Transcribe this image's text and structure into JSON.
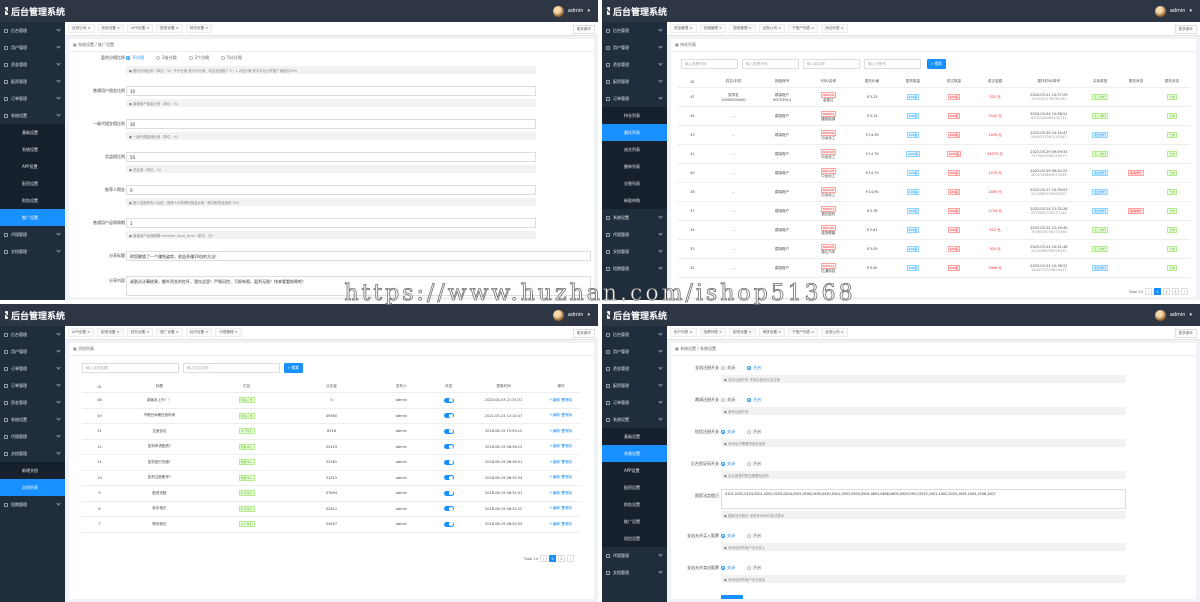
{
  "app": {
    "title": "后台管理系统",
    "user": "admin",
    "more_ops": "更多操作"
  },
  "colors": {
    "header": "#2e3644",
    "sidebar": "#1f2d3d",
    "accent": "#1890ff",
    "danger": "#f5222d",
    "success": "#52c41a"
  },
  "watermark": "https://www.huzhan.com/ishop51368",
  "q1": {
    "sidebar": [
      "后台管理",
      "用户管理",
      "资金管理",
      "配资管理",
      "订单管理",
      "系统设置"
    ],
    "sidebar_sub": [
      "基础设置",
      "系统设置",
      "APP设置",
      "配资设置",
      "财务设置",
      "推广设置"
    ],
    "sidebar_after": [
      "代理管理",
      "文档管理"
    ],
    "tabs": [
      "证券公司",
      "系统设置",
      "APP设置",
      "配资设置",
      "财务设置"
    ],
    "breadcrumb": "系统设置 / 推广设置",
    "rows": [
      {
        "label": "盈利分佣比例",
        "radios": [
          "不分佣",
          "2倍分佣",
          "3个分佣",
          "5分分佣"
        ],
        "hint": "盈利分佣比例（单位：%）不予分佣 表示不分佣，收益全给推广人；1,2倍分佣 表示平台分享推广佣金的20%"
      },
      {
        "label": "普通用户佣金比例",
        "value": "10",
        "hint": "普通用户佣金比例（单位：%）"
      },
      {
        "label": "一级代理金佣比例",
        "value": "30",
        "hint": "一级代理金佣比例（单位：%）"
      },
      {
        "label": "总监佣比例",
        "value": "50",
        "hint": "总监佣（单位：%）"
      },
      {
        "label": "推荐人佣金",
        "value": "0",
        "hint": "推介给推荐有人后进，推荐人可获得的佣金比例（首次配资费用的 5%）"
      },
      {
        "label": "普通用户返佣周期",
        "value": "1",
        "hint": "普通用户返佣周期 member_back_time（单位：天）"
      },
      {
        "label": "分享标题",
        "value": "帮您解锁了一个赚钱姿势，收益多赚10倍的方法!"
      },
      {
        "label": "分享内容",
        "value": "或割试计算结果，额外资金的杠杆，我在这里！严格风控，亏损有限，盈利无限！快来看看结果吧！"
      }
    ]
  },
  "q2": {
    "sidebar_top": [
      "后台管理",
      "用户管理",
      "资金管理",
      "配资管理",
      "订单管理"
    ],
    "sidebar_sub": [
      "持仓列表",
      "委托列表",
      "成交列表",
      "撤单列表",
      "交割列表",
      "新股申购"
    ],
    "sidebar_after": [
      "系统设置",
      "代理管理",
      "文档管理",
      "短期管理"
    ],
    "tabs": [
      "资金管理",
      "充值管理",
      "提现管理",
      "证券公司",
      "子账户列表",
      "持仓列表"
    ],
    "breadcrumb": "持仓列表",
    "search": [
      "输入股票代码",
      "输入股票代码",
      "输入单名称",
      "输入子账号",
      "搜索"
    ],
    "headers": [
      "ID",
      "姓名/手机",
      "报盘账号",
      "代码/名称",
      "委托价格",
      "委托数量",
      "成交数量",
      "成交金额",
      "委托时间/单号",
      "买卖类型",
      "委托状态",
      "委托状态"
    ],
    "rows": [
      {
        "id": "47",
        "name": "张学友",
        "phone": "19000000000",
        "acct": "模拟账户",
        "acct2": "60753914",
        "code": "000016",
        "sname": "金爱达",
        "price": "￥3.25",
        "qty": "100股",
        "done": "100股",
        "amt": "325 元",
        "time": "2024-03-22 10:37:29",
        "no": "1925321176252183",
        "type": "买入委托",
        "st1": "",
        "st2": "已成"
      },
      {
        "id": "44",
        "name": "--",
        "phone": "",
        "acct": "模拟账户",
        "acct2": "",
        "code": "300609",
        "sname": "捷锐能源",
        "price": "￥5.14",
        "qty": "300股",
        "done": "300股",
        "amt": "1542 元",
        "time": "2024-03-04 10:58:51",
        "no": "6792348464100721",
        "type": "买入委托",
        "st1": "",
        "st2": "已成"
      },
      {
        "id": "43",
        "name": "--",
        "phone": "",
        "acct": "模拟账户",
        "acct2": "",
        "code": "600128",
        "sname": "中远化工",
        "price": "￥14.39",
        "qty": "100股",
        "done": "100股",
        "amt": "1439 元",
        "time": "2023-03-30 10:15:47",
        "no": "5065337591142547",
        "type": "卖出委托",
        "st1": "",
        "st2": "已成"
      },
      {
        "id": "41",
        "name": "--",
        "phone": "",
        "acct": "模拟账户",
        "acct2": "",
        "code": "600128",
        "sname": "中远化工",
        "price": "￥14.79",
        "qty": "3000股",
        "done": "3000股",
        "amt": "44370 元",
        "time": "2023-03-29 09:49:33",
        "no": "7575090000054573",
        "type": "买入委托",
        "st1": "",
        "st2": "已成"
      },
      {
        "id": "40",
        "name": "--",
        "phone": "",
        "acct": "模拟账户",
        "acct2": "",
        "code": "600128",
        "sname": "中远化工",
        "price": "￥14.79",
        "qty": "100股",
        "done": "100股",
        "amt": "1479 元",
        "time": "2023-03-29 09:42:21",
        "no": "3632346853514565",
        "type": "卖出委托",
        "st1": "取消委托",
        "st2": "已成"
      },
      {
        "id": "38",
        "name": "--",
        "phone": "",
        "acct": "模拟账户",
        "acct2": "",
        "code": "600128",
        "sname": "中远化工",
        "price": "￥14.90",
        "qty": "100股",
        "done": "100股",
        "amt": "1490 元",
        "time": "2023-03-27 10:30:03",
        "no": "2474969579904523",
        "type": "卖出委托",
        "st1": "",
        "st2": "已成"
      },
      {
        "id": "37",
        "name": "--",
        "phone": "",
        "acct": "模拟账户",
        "acct2": "",
        "code": "300071",
        "sname": "银石股份",
        "price": "￥5.78",
        "qty": "300股",
        "done": "300股",
        "amt": "1734 元",
        "time": "2023-03-24 13:32:28",
        "no": "2570000730537142",
        "type": "卖出委托",
        "st1": "取消委托",
        "st2": "已成"
      },
      {
        "id": "34",
        "name": "--",
        "phone": "",
        "acct": "模拟账户",
        "acct2": "",
        "code": "600139",
        "sname": "强茂健康",
        "price": "￥2.61",
        "qty": "200股",
        "done": "200股",
        "amt": "522 元",
        "time": "2023-03-24 12:29:40",
        "no": "7036306736133180",
        "type": "买入委托",
        "st1": "",
        "st2": "已成"
      },
      {
        "id": "33",
        "name": "--",
        "phone": "",
        "acct": "模拟账户",
        "acct2": "",
        "code": "600658",
        "sname": "德达汽车",
        "price": "￥3.05",
        "qty": "100股",
        "done": "100股",
        "amt": "305 元",
        "time": "2023-03-24 10:51:46",
        "no": "2514266799329125",
        "type": "买入委托",
        "st1": "",
        "st2": "已成"
      },
      {
        "id": "32",
        "name": "--",
        "phone": "",
        "acct": "模拟账户",
        "acct2": "",
        "code": "600211",
        "sname": "亿通科技",
        "price": "￥9.90",
        "qty": "200股",
        "done": "200股",
        "amt": "1986 元",
        "time": "2023-03-24 10:36:57",
        "no": "1434723579625417",
        "type": "卖出委托",
        "st1": "",
        "st2": "已成"
      }
    ],
    "total": "Total 23",
    "pages": [
      "1",
      "2",
      "3"
    ]
  },
  "q3": {
    "sidebar": [
      "后台管理",
      "用户管理",
      "订单管理",
      "订单管理",
      "资金管理",
      "系统设置",
      "代理管理",
      "文档管理"
    ],
    "sidebar_sub": [
      "新增文档",
      "文档列表"
    ],
    "sidebar_after": [
      "短期管理"
    ],
    "tabs": [
      "APP设置",
      "配资设置",
      "财务设置",
      "推广设置",
      "经济设置",
      "代理管理"
    ],
    "breadcrumb": "文档列表",
    "search": [
      "输入文档标题",
      "输入栏目名称",
      "搜索"
    ],
    "headers": [
      "ID",
      "标题",
      "栏目",
      "点击量",
      "发布人",
      "状态",
      "更新时间",
      "操作"
    ],
    "rows": [
      {
        "id": "46",
        "title": "新版本上市！！",
        "cat": "网站公告",
        "clicks": "0",
        "author": "admin",
        "time": "2023-04-03 21:33:31"
      },
      {
        "id": "45",
        "title": "节假日休期在线时间",
        "cat": "网站公告",
        "clicks": "45560",
        "author": "admin",
        "time": "2021-03-24 12:10:47"
      },
      {
        "id": "31",
        "title": "注册协议",
        "cat": "关于我们",
        "clicks": "6316",
        "author": "admin",
        "time": "2018-06-19 15:59:12"
      },
      {
        "id": "12",
        "title": "如何申请配资?",
        "cat": "帮助中心",
        "clicks": "52419",
        "author": "admin",
        "time": "2018-06-19 08:36:13"
      },
      {
        "id": "11",
        "title": "如何进行充值?",
        "cat": "帮助中心",
        "clicks": "52581",
        "author": "admin",
        "time": "2018-06-19 08:36:01"
      },
      {
        "id": "10",
        "title": "如何注册账号?",
        "cat": "帮助中心",
        "clicks": "51815",
        "author": "admin",
        "time": "2018-06-19 08:35:34"
      },
      {
        "id": "9",
        "title": "配资流程",
        "cat": "新手指引",
        "clicks": "57694",
        "author": "admin",
        "time": "2018-06-19 08:32:41"
      },
      {
        "id": "8",
        "title": "新手指引",
        "cat": "新手指引",
        "clicks": "52812",
        "author": "admin",
        "time": "2018-06-19 08:32:22"
      },
      {
        "id": "7",
        "title": "联系我们",
        "cat": "关于我们",
        "clicks": "54697",
        "author": "admin",
        "time": "2018-06-19 08:30:53"
      }
    ],
    "edit": "编辑",
    "del": "删除",
    "total": "Total 14",
    "pages": [
      "1",
      "2"
    ]
  },
  "q4": {
    "sidebar_top": [
      "后台管理",
      "用户管理",
      "资金管理",
      "配资管理",
      "订单管理",
      "系统设置"
    ],
    "sidebar_sub": [
      "基础设置",
      "系统设置",
      "APP设置",
      "配资设置",
      "财务设置",
      "推广设置",
      "短信设置"
    ],
    "sidebar_after": [
      "代理管理",
      "文档管理"
    ],
    "tabs": [
      "用户列表",
      "招聘列表",
      "配资设置",
      "审核设置",
      "子账户列表",
      "证券公司"
    ],
    "breadcrumb": "系统设置 / 系统设置",
    "off": "关闭",
    "on": "开启",
    "rows": [
      {
        "label": "全站注册开关",
        "sel": "on",
        "hint": "全站注册开关 关闭后前台无法注册"
      },
      {
        "label": "邀请注册开关",
        "sel": "on",
        "hint": "邀请注册开关"
      },
      {
        "label": "短信注册开关",
        "sel": "off",
        "hint": "关闭后不需要短信验证码"
      },
      {
        "label": "后台验证码开关",
        "sel": "off",
        "hint": "后台登录时是否需要验证码"
      },
      {
        "label": "国家法定假日",
        "textarea": "0101,0102,0103,0201,0202,0203,0204,0205,0206,0405,0430,0501,0502,0503,0504,0605,0606,0605,0920,0911,0922,1001,1002,2003,1004,1005,1006,1007",
        "hint": "国家法定假日 用逗号MMDD形式表示"
      },
      {
        "label": "全站允许买入股票",
        "sel": "off",
        "hint": "关闭后所有用户无法买入"
      },
      {
        "label": "全站允许卖出股票",
        "sel": "off",
        "hint": "关闭后所有用户无法卖出"
      }
    ]
  }
}
